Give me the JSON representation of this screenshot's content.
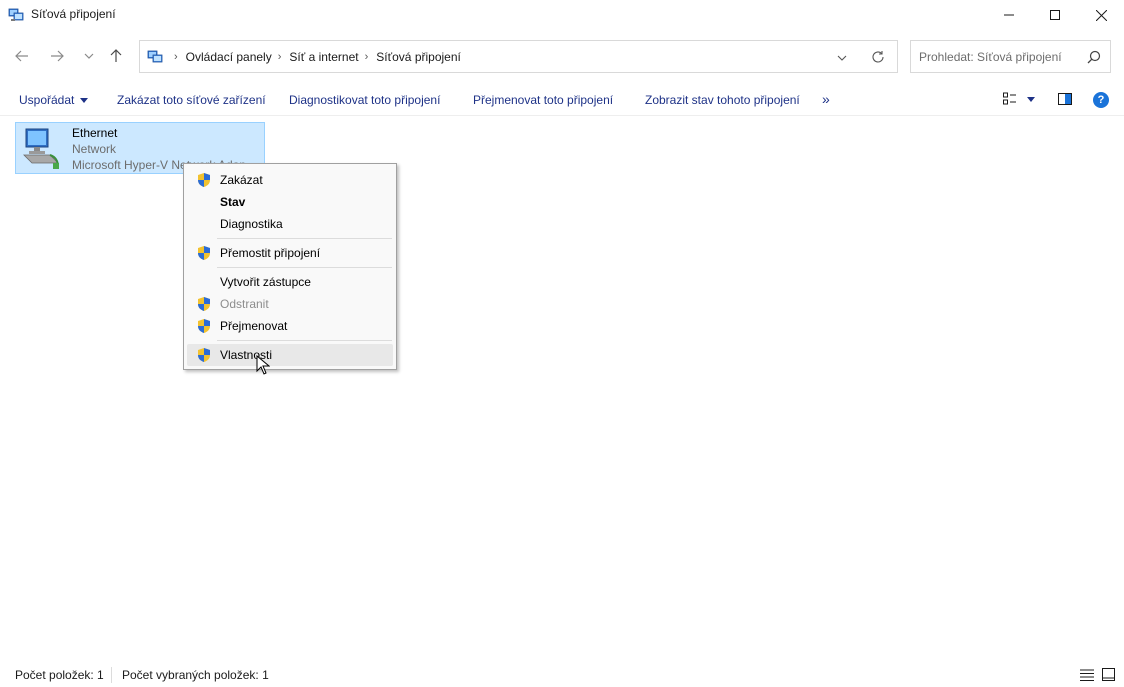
{
  "window": {
    "title": "Síťová připojení",
    "icon": "network-connections-icon"
  },
  "address": {
    "crumbs": [
      "Ovládací panely",
      "Síť a internet",
      "Síťová připojení"
    ]
  },
  "search": {
    "placeholder": "Prohledat: Síťová připojení"
  },
  "toolbar": {
    "organize": "Uspořádat",
    "disable": "Zakázat toto síťové zařízení",
    "diagnose": "Diagnostikovat toto připojení",
    "rename": "Přejmenovat toto připojení",
    "status": "Zobrazit stav tohoto připojení",
    "more": "»",
    "help": "?"
  },
  "item": {
    "name": "Ethernet",
    "status": "Network",
    "device": "Microsoft Hyper-V Network Adap..."
  },
  "context_menu": {
    "items": [
      {
        "label": "Zakázat",
        "shield": true
      },
      {
        "label": "Stav",
        "bold": true
      },
      {
        "label": "Diagnostika"
      },
      {
        "label": "Přemostit připojení",
        "shield": true
      },
      {
        "label": "Vytvořit zástupce"
      },
      {
        "label": "Odstranit",
        "shield": true,
        "disabled": true
      },
      {
        "label": "Přejmenovat",
        "shield": true
      },
      {
        "label": "Vlastnosti",
        "shield": true,
        "hover": true
      }
    ]
  },
  "statusbar": {
    "count": "Počet položek: 1",
    "selected": "Počet vybraných položek: 1"
  },
  "colors": {
    "accent": "#1e3287",
    "selection": "#cce8ff",
    "help": "#1a73d9"
  }
}
